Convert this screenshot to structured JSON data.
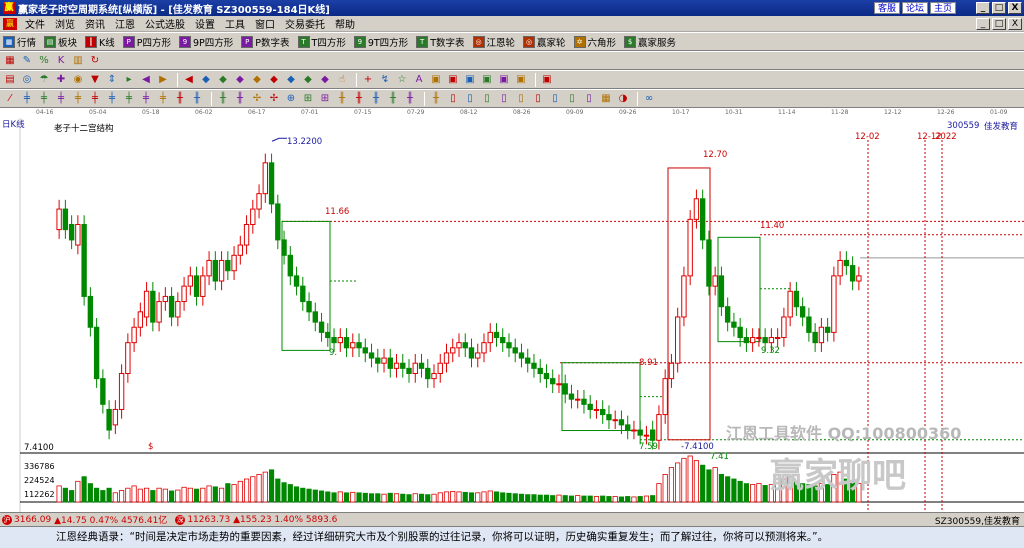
{
  "window": {
    "title": "赢家老子时空周期系统[纵横版] - [佳发教育  SZ300559-184日K线]",
    "links": [
      "客服",
      "论坛",
      "主页"
    ],
    "buttons": [
      "_",
      "□",
      "X"
    ]
  },
  "menu": {
    "items": [
      "文件",
      "浏览",
      "资讯",
      "江恩",
      "公式选股",
      "设置",
      "工具",
      "窗口",
      "交易委托",
      "帮助"
    ]
  },
  "toolbar1": {
    "items": [
      {
        "label": "行情",
        "color": "#1a5fb4",
        "glyph": "▦"
      },
      {
        "label": "板块",
        "color": "#2a7a2a",
        "glyph": "▤"
      },
      {
        "label": "K线",
        "color": "#c00000",
        "glyph": "┃"
      },
      {
        "label": "P四方形",
        "color": "#7a1aa0",
        "glyph": "P"
      },
      {
        "label": "9P四方形",
        "color": "#7a1aa0",
        "glyph": "9"
      },
      {
        "label": "P数字表",
        "color": "#7a1aa0",
        "glyph": "P"
      },
      {
        "label": "T四方形",
        "color": "#2a7a2a",
        "glyph": "T"
      },
      {
        "label": "9T四方形",
        "color": "#2a7a2a",
        "glyph": "9"
      },
      {
        "label": "T数字表",
        "color": "#2a7a2a",
        "glyph": "T"
      },
      {
        "label": "江恩轮",
        "color": "#b03000",
        "glyph": "◎"
      },
      {
        "label": "赢家轮",
        "color": "#b03000",
        "glyph": "◎"
      },
      {
        "label": "六角形",
        "color": "#b07000",
        "glyph": "✡"
      },
      {
        "label": "赢家服务",
        "color": "#2a7a2a",
        "glyph": "$"
      }
    ]
  },
  "toolbar2": {
    "icons": [
      "grid-icon",
      "pen-icon",
      "percent-icon",
      "k-icon",
      "bar-icon",
      "refresh-icon"
    ],
    "glyphs": [
      "▦",
      "✎",
      "%",
      "K",
      "▥",
      "↻"
    ]
  },
  "toolbar3": {
    "glyphs": [
      "▤",
      "◎",
      "☂",
      "✚",
      "◉",
      "▼",
      "⇕",
      "▸",
      "◀",
      "▶",
      "◀",
      "◆",
      "◆",
      "◆",
      "◆",
      "◆",
      "◆",
      "◆",
      "◆",
      "☝",
      "+",
      "↯",
      "☆",
      "A",
      "▣",
      "▣",
      "▣",
      "▣",
      "▣",
      "▣",
      "▣"
    ]
  },
  "toolbar4": {
    "glyphs": [
      "⁄",
      "╪",
      "╪",
      "╪",
      "╪",
      "╪",
      "╪",
      "╪",
      "╪",
      "╪",
      "╫",
      "╫",
      "╫",
      "╫",
      "✢",
      "✢",
      "⊕",
      "⊞",
      "⊞",
      "╫",
      "╫",
      "╫",
      "╫",
      "╫",
      "╫",
      "▯",
      "▯",
      "▯",
      "▯",
      "▯",
      "▯",
      "▯",
      "▯",
      "▯",
      "▦",
      "◑",
      "∞"
    ]
  },
  "dates": [
    "04-16",
    "05-04",
    "05-18",
    "06-02",
    "06-17",
    "07-01",
    "07-15",
    "07-29",
    "08-12",
    "08-26",
    "09-09",
    "09-26",
    "10-17",
    "10-31",
    "11-14",
    "11-28",
    "12-12",
    "12-26",
    "01-09"
  ],
  "chart": {
    "period_label": "日K线",
    "structure_label": "老子十二宫结构",
    "stock_code": "300559",
    "stock_name": "佳发教育",
    "date_markers": [
      "12-02",
      "12-12",
      "2022"
    ],
    "price_labels": {
      "high": "13.2200",
      "p1266": "12.70",
      "p1166": "11.66",
      "p1140": "11.40",
      "p891": "8.91",
      "p932": "9.32",
      "p759": "7.59",
      "p741": "-7.4100",
      "p741b": "7.41",
      "p9": "9."
    },
    "axis_low": "7.4100",
    "dollar_mark": "$",
    "volume_ticks": [
      "336786",
      "224524",
      "112262"
    ],
    "watermark_software": "江恩工具软件  QQ:100800360",
    "watermark_forum": "赢家聊吧"
  },
  "chart_data": {
    "type": "candlestick",
    "symbol": "SZ300559",
    "name": "佳发教育",
    "period": "日K线",
    "high_price": 13.22,
    "low_price": 7.41,
    "levels": [
      13.22,
      12.7,
      11.66,
      11.4,
      8.91,
      9.32,
      7.59,
      7.41
    ],
    "closes": [
      11.9,
      11.5,
      11.3,
      11.6,
      10.2,
      9.6,
      8.6,
      8.1,
      7.6,
      8.0,
      8.7,
      9.3,
      9.6,
      9.9,
      10.3,
      9.7,
      10.1,
      10.2,
      9.8,
      10.1,
      10.4,
      10.6,
      10.2,
      10.6,
      10.9,
      10.5,
      10.9,
      10.7,
      11.0,
      11.2,
      11.6,
      11.9,
      12.2,
      12.8,
      12.0,
      11.3,
      11.0,
      10.6,
      10.4,
      10.1,
      9.9,
      9.7,
      9.5,
      9.4,
      9.3,
      9.4,
      9.2,
      9.3,
      9.2,
      9.1,
      9.0,
      8.9,
      9.0,
      8.8,
      8.9,
      8.8,
      8.7,
      8.9,
      8.8,
      8.6,
      8.7,
      8.9,
      9.1,
      9.2,
      9.3,
      9.2,
      9.0,
      9.1,
      9.3,
      9.5,
      9.4,
      9.3,
      9.2,
      9.1,
      9.0,
      8.9,
      8.8,
      8.7,
      8.6,
      8.5,
      8.5,
      8.3,
      8.2,
      8.2,
      8.1,
      8.0,
      8.0,
      7.9,
      7.8,
      7.8,
      7.7,
      7.6,
      7.6,
      7.5,
      7.5,
      7.4,
      7.9,
      8.6,
      8.9,
      9.8,
      10.6,
      11.7,
      12.1,
      11.3,
      10.4,
      10.6,
      10.0,
      9.7,
      9.6,
      9.4,
      9.3,
      9.4,
      9.4,
      9.3,
      9.4,
      9.4,
      9.8,
      10.3,
      10.0,
      9.8,
      9.5,
      9.3,
      9.6,
      9.5,
      10.6,
      10.9,
      10.8,
      10.5,
      10.6
    ],
    "opens": [
      11.5,
      11.9,
      11.6,
      11.2,
      11.6,
      10.2,
      9.6,
      8.6,
      8.0,
      7.7,
      8.0,
      8.7,
      9.3,
      9.6,
      9.8,
      10.3,
      9.7,
      10.1,
      10.2,
      9.8,
      10.1,
      10.4,
      10.6,
      10.2,
      10.6,
      10.9,
      10.5,
      10.9,
      10.7,
      11.0,
      11.2,
      11.6,
      11.9,
      12.2,
      12.8,
      12.0,
      11.3,
      11.0,
      10.6,
      10.4,
      10.1,
      9.9,
      9.7,
      9.5,
      9.4,
      9.3,
      9.4,
      9.2,
      9.3,
      9.2,
      9.1,
      9.0,
      8.9,
      9.0,
      8.8,
      8.9,
      8.8,
      8.7,
      8.9,
      8.8,
      8.6,
      8.7,
      8.9,
      9.1,
      9.2,
      9.3,
      9.2,
      9.0,
      9.1,
      9.3,
      9.5,
      9.4,
      9.3,
      9.2,
      9.1,
      9.0,
      8.9,
      8.8,
      8.7,
      8.6,
      8.5,
      8.5,
      8.3,
      8.2,
      8.2,
      8.1,
      8.0,
      8.0,
      7.9,
      7.8,
      7.8,
      7.7,
      7.6,
      7.6,
      7.5,
      7.6,
      7.4,
      7.9,
      8.6,
      8.9,
      9.8,
      10.6,
      11.7,
      12.1,
      11.3,
      10.4,
      10.6,
      10.0,
      9.7,
      9.6,
      9.4,
      9.3,
      9.4,
      9.4,
      9.3,
      9.4,
      9.4,
      9.8,
      10.3,
      10.0,
      9.8,
      9.5,
      9.3,
      9.6,
      9.5,
      10.6,
      10.9,
      10.8,
      10.5
    ],
    "volumes_relative": [
      0.35,
      0.3,
      0.25,
      0.45,
      0.55,
      0.4,
      0.3,
      0.25,
      0.3,
      0.2,
      0.25,
      0.3,
      0.35,
      0.28,
      0.3,
      0.25,
      0.3,
      0.28,
      0.24,
      0.26,
      0.32,
      0.3,
      0.28,
      0.3,
      0.35,
      0.33,
      0.3,
      0.4,
      0.38,
      0.45,
      0.5,
      0.55,
      0.6,
      0.65,
      0.7,
      0.5,
      0.42,
      0.38,
      0.33,
      0.3,
      0.28,
      0.26,
      0.24,
      0.22,
      0.2,
      0.22,
      0.2,
      0.21,
      0.2,
      0.19,
      0.18,
      0.18,
      0.17,
      0.19,
      0.18,
      0.17,
      0.16,
      0.18,
      0.17,
      0.16,
      0.17,
      0.2,
      0.22,
      0.23,
      0.22,
      0.21,
      0.2,
      0.2,
      0.22,
      0.24,
      0.22,
      0.2,
      0.19,
      0.18,
      0.17,
      0.16,
      0.16,
      0.15,
      0.15,
      0.14,
      0.15,
      0.14,
      0.13,
      0.14,
      0.13,
      0.13,
      0.12,
      0.13,
      0.12,
      0.12,
      0.11,
      0.12,
      0.11,
      0.12,
      0.13,
      0.14,
      0.4,
      0.6,
      0.75,
      0.85,
      0.95,
      1.0,
      0.9,
      0.8,
      0.7,
      0.75,
      0.6,
      0.55,
      0.5,
      0.45,
      0.4,
      0.38,
      0.4,
      0.36,
      0.38,
      0.4,
      0.5,
      0.55,
      0.45,
      0.4,
      0.38,
      0.35,
      0.4,
      0.38,
      0.6,
      0.65,
      0.5,
      0.45,
      0.4
    ]
  },
  "status": {
    "sh_value": "3166.09",
    "sh_change": "▲14.75 0.47% 4576.41亿",
    "sz_value": "11263.73",
    "sz_change": "▲155.23 1.40% 5893.6",
    "right": "SZ300559,佳发教育"
  },
  "footer": {
    "quote": "江恩经典语录：“时间是决定市场走势的重要因素，经过详细研究大市及个别股票的过往记录，你将可以证明，历史确实重复发生；而了解过往，你将可以预测将来。”。"
  },
  "colors": {
    "up": "#e00000",
    "down": "#008800",
    "box_green": "#008800",
    "box_red": "#cc0000",
    "label_blue": "#1a1aa0"
  }
}
